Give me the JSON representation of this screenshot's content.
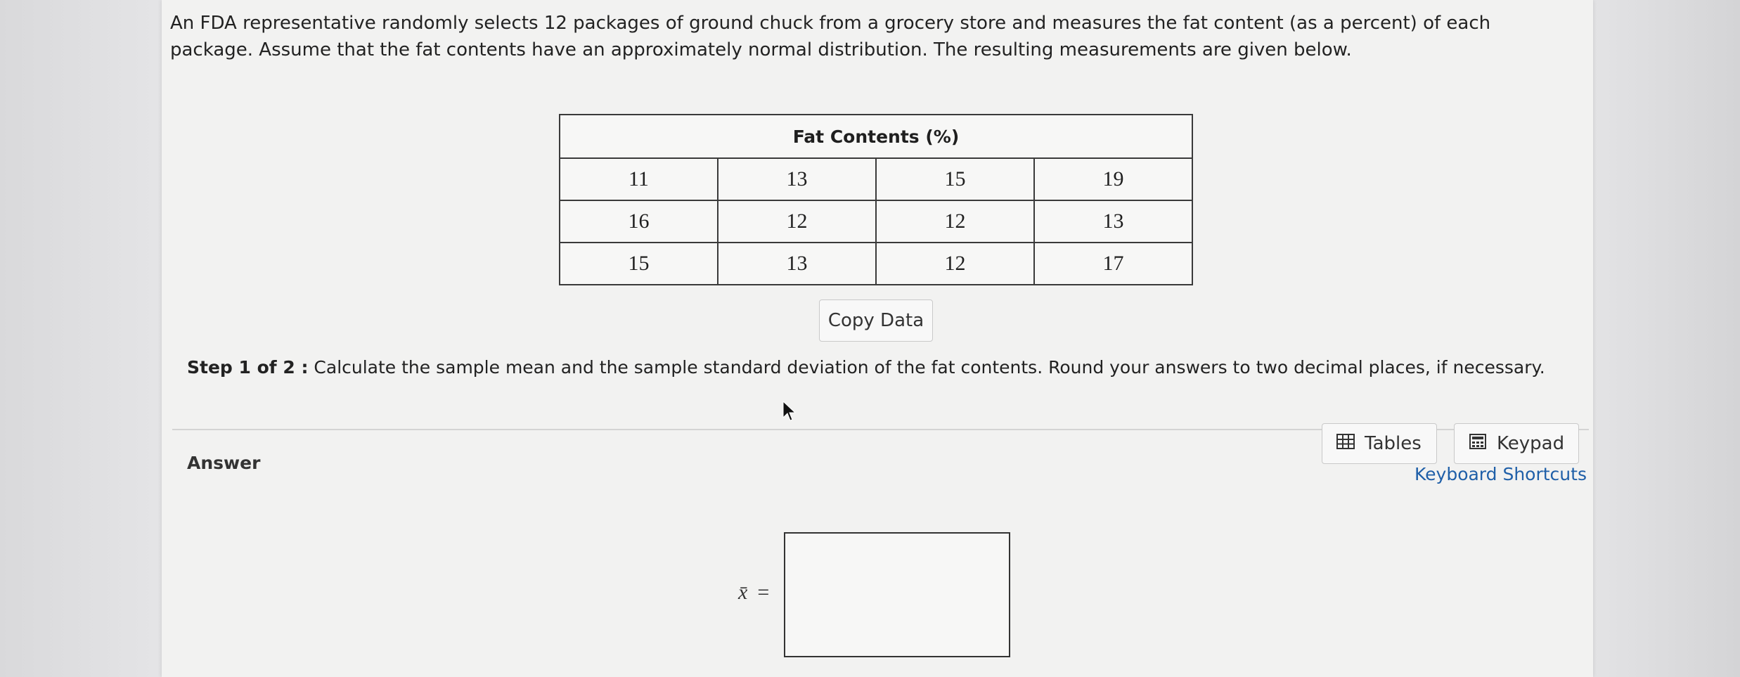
{
  "problem": {
    "text": "An FDA representative randomly selects 12 packages of ground chuck from a grocery store and measures the fat content (as a percent) of each package. Assume that the fat contents have an approximately normal distribution. The resulting measurements are given below."
  },
  "table": {
    "header": "Fat Contents (%)",
    "rows": [
      [
        "11",
        "13",
        "15",
        "19"
      ],
      [
        "16",
        "12",
        "12",
        "13"
      ],
      [
        "15",
        "13",
        "12",
        "17"
      ]
    ]
  },
  "buttons": {
    "copy_data": "Copy Data",
    "tables": "Tables",
    "keypad": "Keypad",
    "keyboard_shortcuts": "Keyboard Shortcuts"
  },
  "step": {
    "label": "Step 1 of 2 :",
    "text": " Calculate the sample mean and the sample standard deviation of the fat contents. Round your answers to two decimal places, if necessary."
  },
  "answer": {
    "label": "Answer",
    "xbar_symbol": "x̄",
    "equals": "=",
    "xbar_value": ""
  },
  "icons": {
    "tables": "table-grid-icon",
    "keypad": "calculator-icon",
    "cursor": "mouse-pointer-icon"
  }
}
